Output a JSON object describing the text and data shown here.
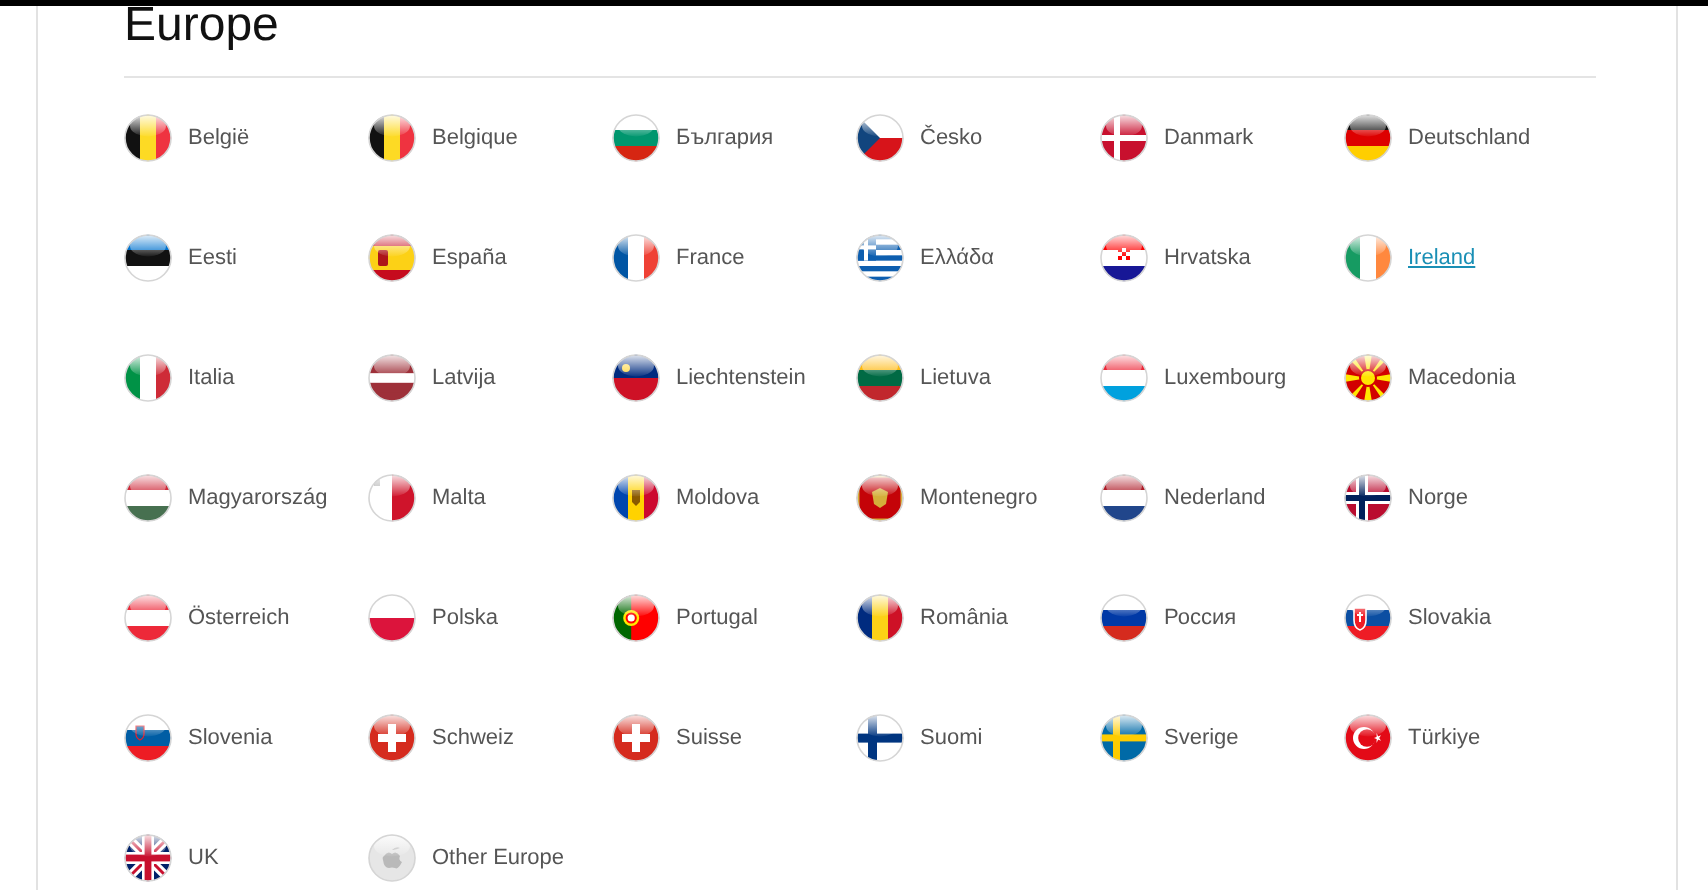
{
  "section": {
    "title": "Europe"
  },
  "countries": [
    {
      "name": "België",
      "hovered": false
    },
    {
      "name": "Belgique",
      "hovered": false
    },
    {
      "name": "България",
      "hovered": false
    },
    {
      "name": "Česko",
      "hovered": false
    },
    {
      "name": "Danmark",
      "hovered": false
    },
    {
      "name": "Deutschland",
      "hovered": false
    },
    {
      "name": "Eesti",
      "hovered": false
    },
    {
      "name": "España",
      "hovered": false
    },
    {
      "name": "France",
      "hovered": false
    },
    {
      "name": "Ελλάδα",
      "hovered": false
    },
    {
      "name": "Hrvatska",
      "hovered": false
    },
    {
      "name": "Ireland",
      "hovered": true
    },
    {
      "name": "Italia",
      "hovered": false
    },
    {
      "name": "Latvija",
      "hovered": false
    },
    {
      "name": "Liechtenstein",
      "hovered": false
    },
    {
      "name": "Lietuva",
      "hovered": false
    },
    {
      "name": "Luxembourg",
      "hovered": false
    },
    {
      "name": "Macedonia",
      "hovered": false
    },
    {
      "name": "Magyarország",
      "hovered": false
    },
    {
      "name": "Malta",
      "hovered": false
    },
    {
      "name": "Moldova",
      "hovered": false
    },
    {
      "name": "Montenegro",
      "hovered": false
    },
    {
      "name": "Nederland",
      "hovered": false
    },
    {
      "name": "Norge",
      "hovered": false
    },
    {
      "name": "Österreich",
      "hovered": false
    },
    {
      "name": "Polska",
      "hovered": false
    },
    {
      "name": "Portugal",
      "hovered": false
    },
    {
      "name": "România",
      "hovered": false
    },
    {
      "name": "Россия",
      "hovered": false
    },
    {
      "name": "Slovakia",
      "hovered": false
    },
    {
      "name": "Slovenia",
      "hovered": false
    },
    {
      "name": "Schweiz",
      "hovered": false
    },
    {
      "name": "Suisse",
      "hovered": false
    },
    {
      "name": "Suomi",
      "hovered": false
    },
    {
      "name": "Sverige",
      "hovered": false
    },
    {
      "name": "Türkiye",
      "hovered": false
    },
    {
      "name": "UK",
      "hovered": false
    },
    {
      "name": "Other Europe",
      "hovered": false
    }
  ]
}
